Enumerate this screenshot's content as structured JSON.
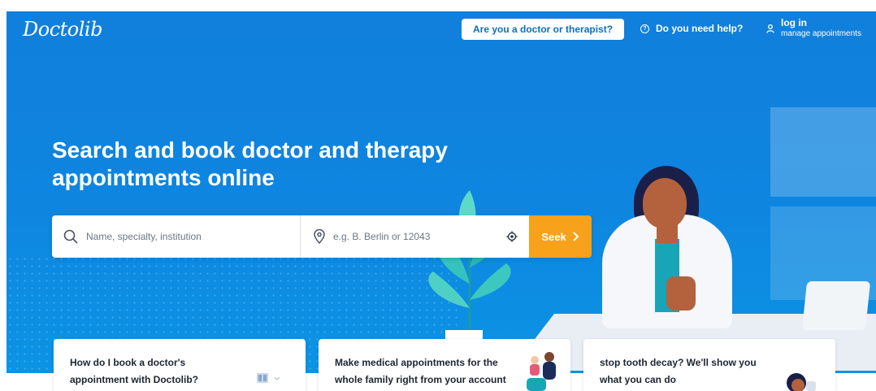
{
  "header": {
    "logo_text": "Doctolib",
    "pro_button_label": "Are you a doctor or therapist?",
    "help_label": "Do you need help?",
    "login_label": "log in",
    "manage_label": "manage appointments"
  },
  "hero": {
    "headline": "Search and book doctor and therapy appointments online",
    "search": {
      "name_placeholder": "Name, specialty, institution",
      "location_placeholder": "e.g. B. Berlin or 12043",
      "seek_label": "Seek"
    }
  },
  "cards": [
    {
      "text": "How do I book a doctor's appointment with Doctolib?"
    },
    {
      "text": "Make medical appointments for the whole family right from your account"
    },
    {
      "text": "stop tooth decay? We'll show you what you can do"
    }
  ],
  "colors": {
    "hero_blue": "#117fdc",
    "seek_orange": "#f7a21a",
    "pro_button_text": "#0b6ec3"
  },
  "icons": [
    "search-icon",
    "location-pin-icon",
    "locate-me-icon",
    "chevron-right-icon",
    "help-circle-icon",
    "user-icon"
  ]
}
